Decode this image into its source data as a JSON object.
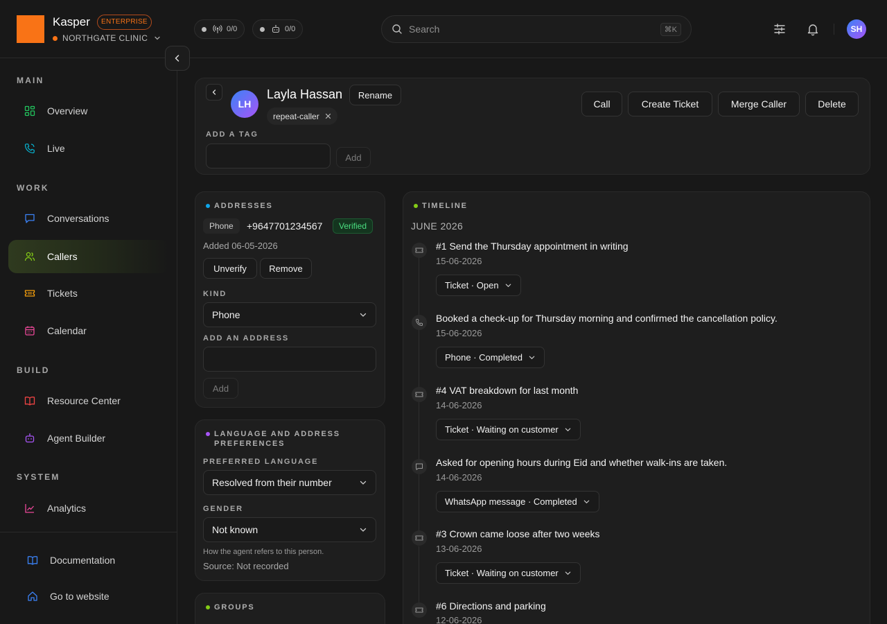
{
  "app": {
    "brand": "Kasper",
    "plan_badge": "ENTERPRISE",
    "org_name": "NORTHGATE CLINIC",
    "org_color": "#f97316",
    "accent_color": "#84cc16"
  },
  "topbar": {
    "status_calls": "0/0",
    "status_agents": "0/0",
    "search_placeholder": "Search",
    "search_shortcut": "⌘K",
    "user_initials": "SH"
  },
  "sidebar": {
    "sections": {
      "main": "MAIN",
      "work": "WORK",
      "build": "BUILD",
      "system": "SYSTEM"
    },
    "items": [
      {
        "label": "Overview",
        "icon": "grid-icon"
      },
      {
        "label": "Live",
        "icon": "phone-ringing-icon"
      },
      {
        "label": "Conversations",
        "icon": "chat-icon"
      },
      {
        "label": "Callers",
        "icon": "users-icon",
        "active": true
      },
      {
        "label": "Tickets",
        "icon": "ticket-icon"
      },
      {
        "label": "Calendar",
        "icon": "calendar-icon"
      },
      {
        "label": "Resource Center",
        "icon": "book-icon"
      },
      {
        "label": "Agent Builder",
        "icon": "robot-icon"
      },
      {
        "label": "Analytics",
        "icon": "chart-line-icon"
      }
    ],
    "footer": [
      {
        "label": "Documentation",
        "icon": "book-open-icon"
      },
      {
        "label": "Go to website",
        "icon": "home-icon"
      }
    ]
  },
  "caller": {
    "initials": "LH",
    "name": "Layla Hassan",
    "rename_label": "Rename",
    "tags": [
      "repeat-caller"
    ],
    "add_tag_label": "ADD A TAG",
    "add_tag_value": "",
    "add_button": "Add",
    "actions": [
      "Call",
      "Create Ticket",
      "Merge Caller",
      "Delete"
    ]
  },
  "addresses": {
    "heading": "ADDRESSES",
    "dot_color": "#0ea5e9",
    "entry": {
      "type": "Phone",
      "value": "+9647701234567",
      "status": "Verified",
      "added": "Added 06-05-2026",
      "unverify": "Unverify",
      "remove": "Remove"
    },
    "kind_label": "KIND",
    "kind_value": "Phone",
    "add_address_label": "ADD AN ADDRESS",
    "add_address_value": "",
    "add_button": "Add"
  },
  "preferences": {
    "heading": "LANGUAGE AND ADDRESS PREFERENCES",
    "dot_color": "#a855f7",
    "language_label": "PREFERRED LANGUAGE",
    "language_value": "Resolved from their number",
    "gender_label": "GENDER",
    "gender_value": "Not known",
    "gender_hint": "How the agent refers to this person.",
    "source": "Source: Not recorded"
  },
  "groups": {
    "heading": "GROUPS",
    "dot_color": "#84cc16"
  },
  "timeline": {
    "heading": "TIMELINE",
    "dot_color": "#84cc16",
    "month": "JUNE 2026",
    "events": [
      {
        "icon": "ticket-icon",
        "title": "#1 Send the Thursday appointment in writing",
        "date": "15-06-2026",
        "chip": "Ticket · Open"
      },
      {
        "icon": "phone-icon",
        "title": "Booked a check-up for Thursday morning and confirmed the cancellation policy.",
        "date": "15-06-2026",
        "chip": "Phone · Completed"
      },
      {
        "icon": "ticket-icon",
        "title": "#4 VAT breakdown for last month",
        "date": "14-06-2026",
        "chip": "Ticket · Waiting on customer"
      },
      {
        "icon": "message-icon",
        "title": "Asked for opening hours during Eid and whether walk-ins are taken.",
        "date": "14-06-2026",
        "chip": "WhatsApp message · Completed"
      },
      {
        "icon": "ticket-icon",
        "title": "#3 Crown came loose after two weeks",
        "date": "13-06-2026",
        "chip": "Ticket · Waiting on customer"
      },
      {
        "icon": "ticket-icon",
        "title": "#6 Directions and parking",
        "date": "12-06-2026",
        "chip": ""
      }
    ]
  }
}
